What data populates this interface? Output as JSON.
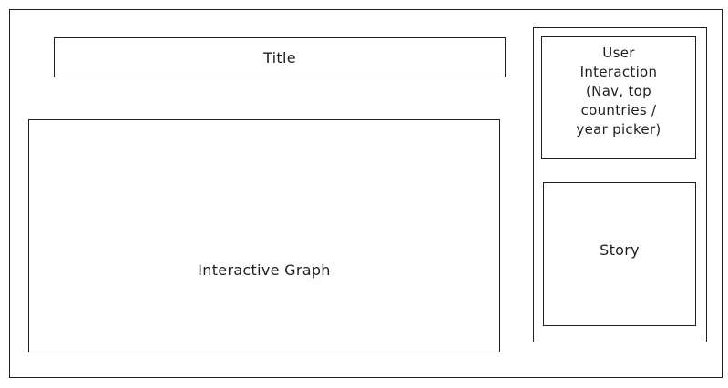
{
  "wireframe": {
    "title_label": "Title",
    "graph_label": "Interactive Graph",
    "user_interaction_lines": [
      "User",
      "Interaction",
      "(Nav, top",
      "countries /",
      "year picker)"
    ],
    "story_label": "Story"
  }
}
